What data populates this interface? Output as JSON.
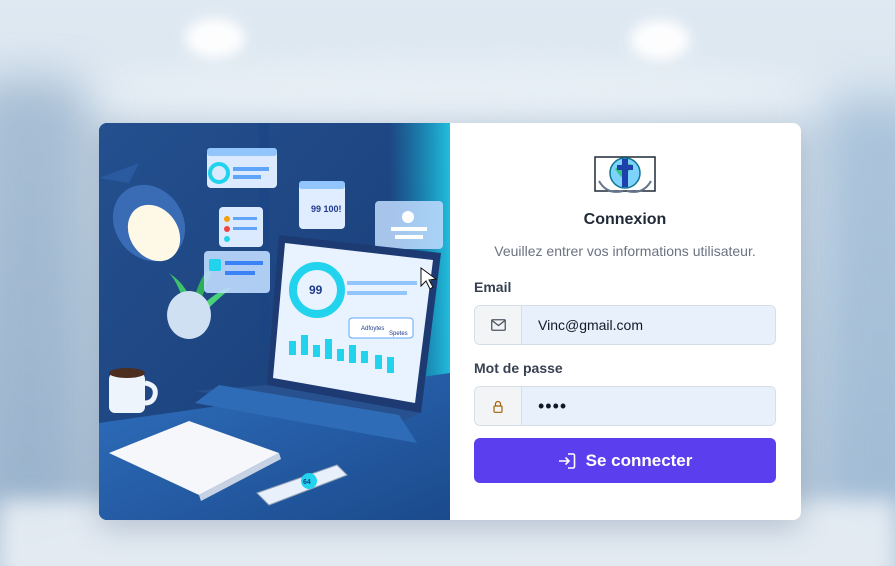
{
  "login": {
    "title": "Connexion",
    "subtitle": "Veuillez entrer vos informations utilisateur.",
    "email_label": "Email",
    "email_value": "Vinc@gmail.com",
    "password_label": "Mot de passe",
    "password_value": "••••",
    "submit_label": "Se connecter"
  },
  "illustration": {
    "dashboard_number": "99",
    "popup_number": "99 100!",
    "card_label_1": "Adfoytes",
    "card_label_2": "Spetes",
    "phone_number": "64"
  },
  "icons": {
    "email": "envelope-icon",
    "password": "lock-icon",
    "submit": "login-icon"
  },
  "colors": {
    "accent": "#5b3fef",
    "input_bg": "#e8f0fc",
    "illustration_bg": "#1e5da2"
  }
}
